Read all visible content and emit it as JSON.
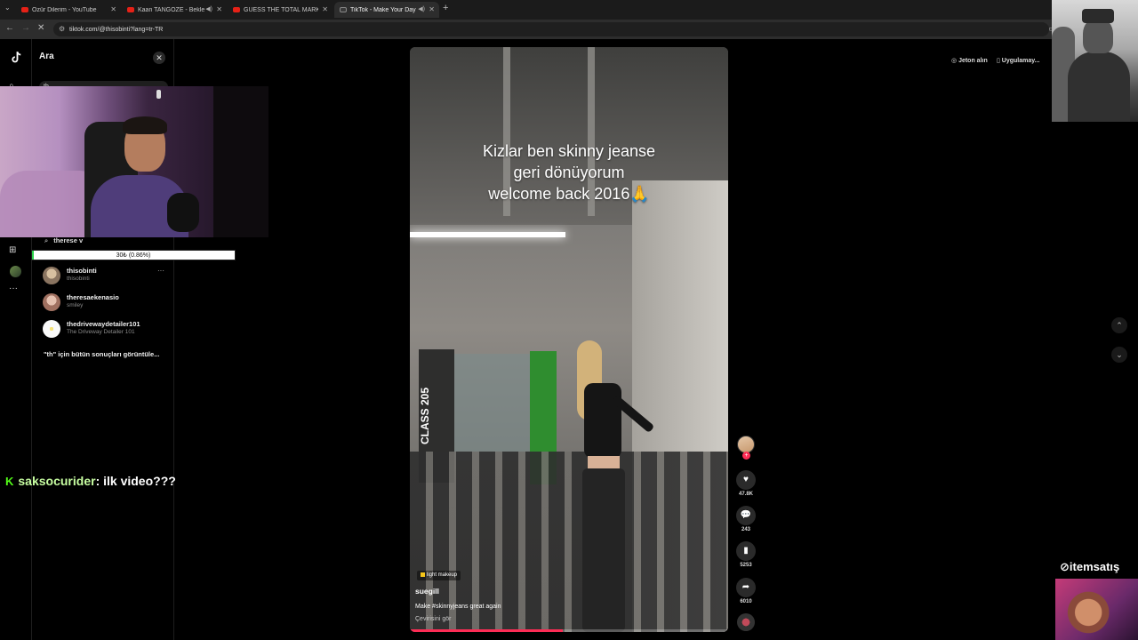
{
  "browser": {
    "tabs": [
      {
        "label": "Özür Dilerim - YouTube",
        "icon": "youtube-icon",
        "active": false
      },
      {
        "label": "Kaan TANGÖZE - Bekle Dedi...",
        "icon": "youtube-icon",
        "active": false
      },
      {
        "label": "GUESS THE TOTAL MARKET VAL",
        "icon": "youtube-icon",
        "active": false
      },
      {
        "label": "TikTok - Make Your Day",
        "icon": "tiktok-icon",
        "active": true
      }
    ],
    "url": "tiktok.com/@thisobinti?lang=tr-TR"
  },
  "sidebar": {
    "title": "Ara",
    "search_value": "th",
    "recent_search": "therese v",
    "results": [
      {
        "name": "thisobinti",
        "sub": "thisobinti"
      },
      {
        "name": "theresaekenasio",
        "sub": "smiley"
      },
      {
        "name": "thedrivewaydetailer101",
        "sub": "The Driveway Detailer 101"
      }
    ],
    "all_results": "\"th\" için bütün sonuçları görüntüle..."
  },
  "overlay_progress": {
    "text": "30₺ (0.86%)",
    "fraction": 0.0086
  },
  "chat": {
    "username": "saksocurider",
    "separator": ":",
    "message": "ilk video???",
    "badge": "K"
  },
  "video": {
    "caption": [
      "Kizlar ben skinny jeanse",
      "geri dönüyorum",
      "welcome back 2016🙏"
    ],
    "wall_text": "CLASS 205",
    "tag": "light makeup",
    "author": "suegill",
    "description": "Make #skinnyjeans great again",
    "translate": "Çevirisini gör",
    "progress_fraction": 0.48
  },
  "actions": [
    {
      "icon": "heart-icon",
      "count": "47.8K"
    },
    {
      "icon": "comment-icon",
      "count": "243"
    },
    {
      "icon": "bookmark-icon",
      "count": "5253"
    },
    {
      "icon": "share-icon",
      "count": "6010"
    }
  ],
  "top_right": {
    "coins": "Jeton alın",
    "app": "Uygulamay..."
  },
  "brand": "itemsatış",
  "colors": {
    "accent": "#fe2c55",
    "chat_badge": "#53fc18",
    "progress_fill": "#2bd34a"
  }
}
